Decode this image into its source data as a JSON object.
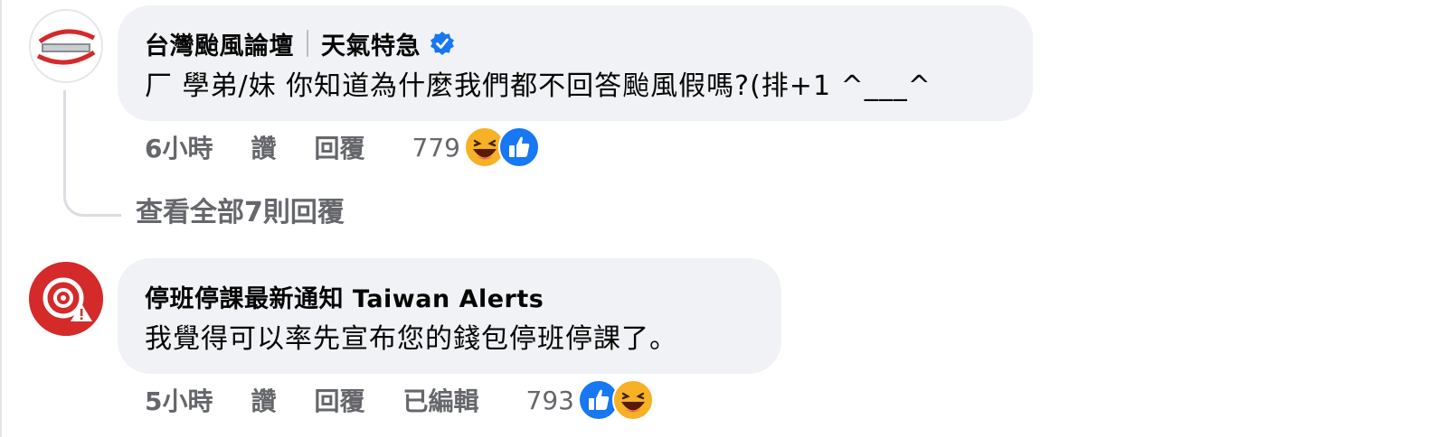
{
  "comments": [
    {
      "author": "台灣颱風論壇",
      "author_tag": "天氣特急",
      "verified": true,
      "text": "厂 學弟/妹 你知道為什麼我們都不回答颱風假嗎?(排+1 ^___^",
      "time": "6小時",
      "like_label": "讚",
      "reply_label": "回覆",
      "reaction_count": "779",
      "reactions": [
        "haha-icon",
        "like-icon"
      ],
      "view_replies": "查看全部7則回覆"
    },
    {
      "author": "停班停課最新通知 Taiwan Alerts",
      "text": "我覺得可以率先宣布您的錢包停班停課了。",
      "time": "5小時",
      "like_label": "讚",
      "reply_label": "回覆",
      "edited_label": "已編輯",
      "reaction_count": "793",
      "reactions": [
        "like-icon",
        "haha-icon"
      ]
    }
  ],
  "colors": {
    "bubble": "#f0f2f5",
    "secondary_text": "#65676b",
    "like_blue": "#1877f2",
    "haha_yellow": "#f7b125",
    "alerts_red": "#d42a2a"
  }
}
